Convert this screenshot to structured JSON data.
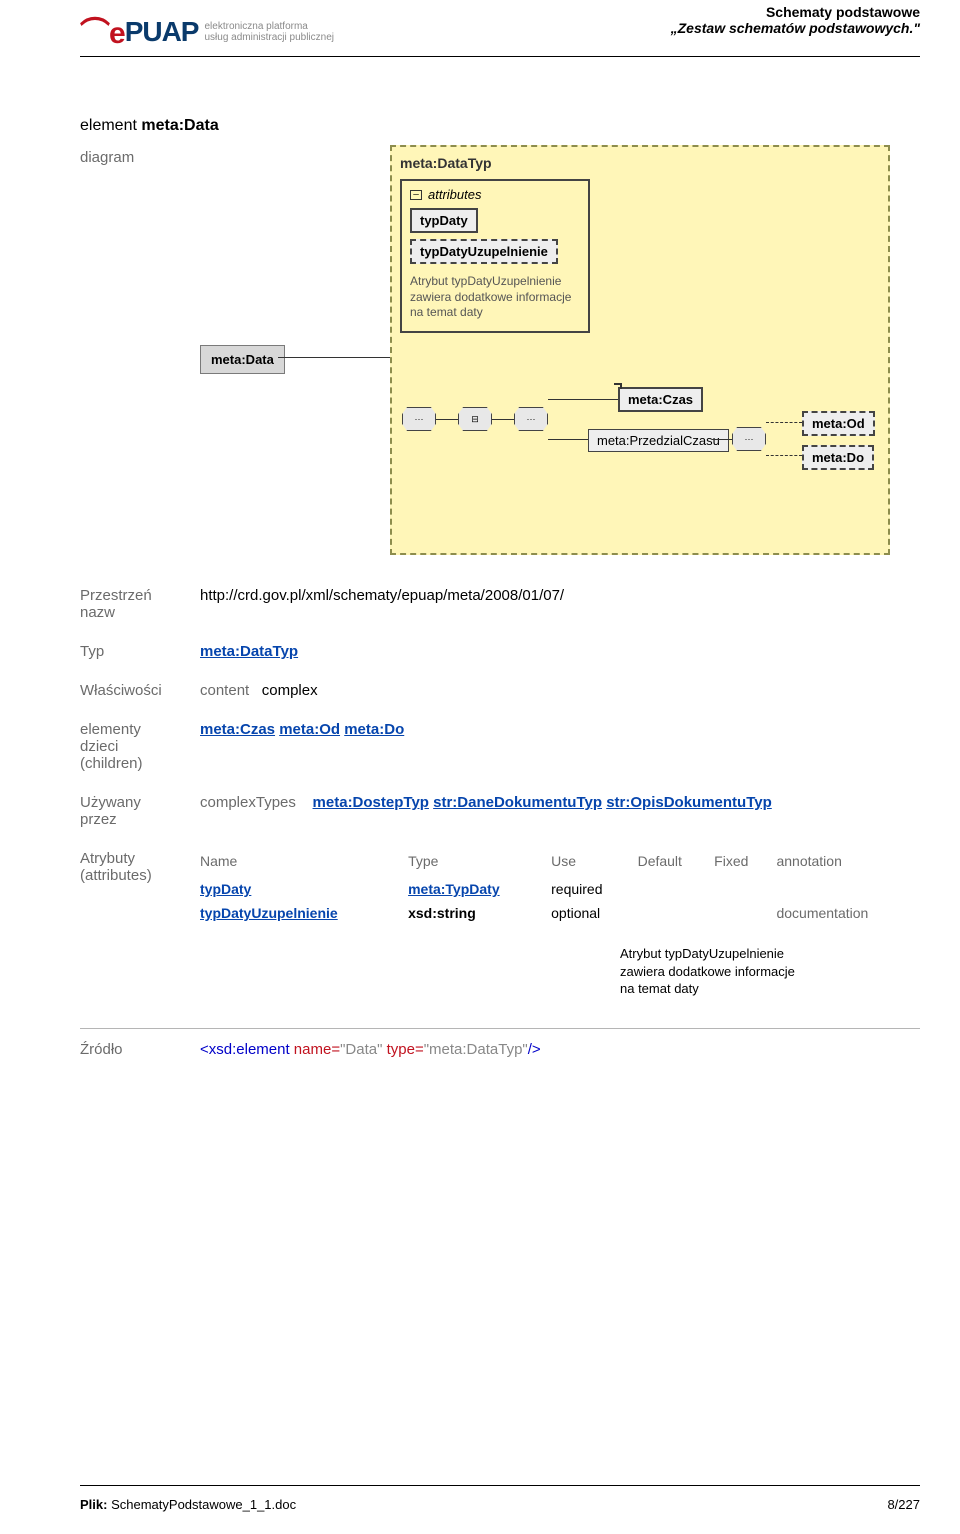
{
  "header": {
    "logo_text": "PUAP",
    "logo_sub1": "elektroniczna platforma",
    "logo_sub2": "usług administracji publicznej",
    "right1": "Schematy podstawowe",
    "right2": "„Zestaw schematów podstawowych.\""
  },
  "title_pre": "element ",
  "title_bold": "meta:Data",
  "labels": {
    "diagram": "diagram",
    "namespace": "Przestrzeń nazw",
    "type": "Typ",
    "properties": "Właściwości",
    "children": "elementy dzieci (children)",
    "usedby": "Używany przez",
    "attributes": "Atrybuty (attributes)",
    "source": "Źródło"
  },
  "diagram": {
    "root": "meta:Data",
    "box_title": "meta:DataTyp",
    "attr_head": "attributes",
    "attr1": "typDaty",
    "attr2": "typDatyUzupelnienie",
    "attr_note": "Atrybut typDatyUzupelnienie zawiera dodatkowe informacje na temat daty",
    "node_czas": "meta:Czas",
    "node_przedzial": "meta:PrzedzialCzasu",
    "node_od": "meta:Od",
    "node_do": "meta:Do"
  },
  "namespace_url": "http://crd.gov.pl/xml/schematy/epuap/meta/2008/01/07/",
  "type_link": "meta:DataTyp",
  "properties": {
    "k": "content",
    "v": "complex"
  },
  "children_links": [
    "meta:Czas",
    "meta:Od",
    "meta:Do"
  ],
  "usedby": {
    "k": "complexTypes",
    "links": [
      "meta:DostepTyp",
      "str:DaneDokumentuTyp",
      "str:OpisDokumentuTyp"
    ]
  },
  "attr_table": {
    "head": [
      "Name",
      "Type",
      "Use",
      "Default",
      "Fixed",
      "annotation"
    ],
    "rows": [
      {
        "name": "typDaty",
        "type": "meta:TypDaty",
        "use": "required",
        "ann": ""
      },
      {
        "name": "typDatyUzupelnienie",
        "type": "xsd:string",
        "use": "optional",
        "ann": "documentation"
      }
    ]
  },
  "doc_note": "Atrybut typDatyUzupelnienie zawiera dodatkowe informacje na temat daty",
  "source_xml": {
    "open": "<xsd:element",
    "name_k": " name=",
    "name_v": "\"Data\"",
    "type_k": " type=",
    "type_v": "\"meta:DataTyp\"",
    "close": "/>"
  },
  "footer": {
    "file_k": "Plik:",
    "file_v": "SchematyPodstawowe_1_1.doc",
    "page": "8/227"
  }
}
